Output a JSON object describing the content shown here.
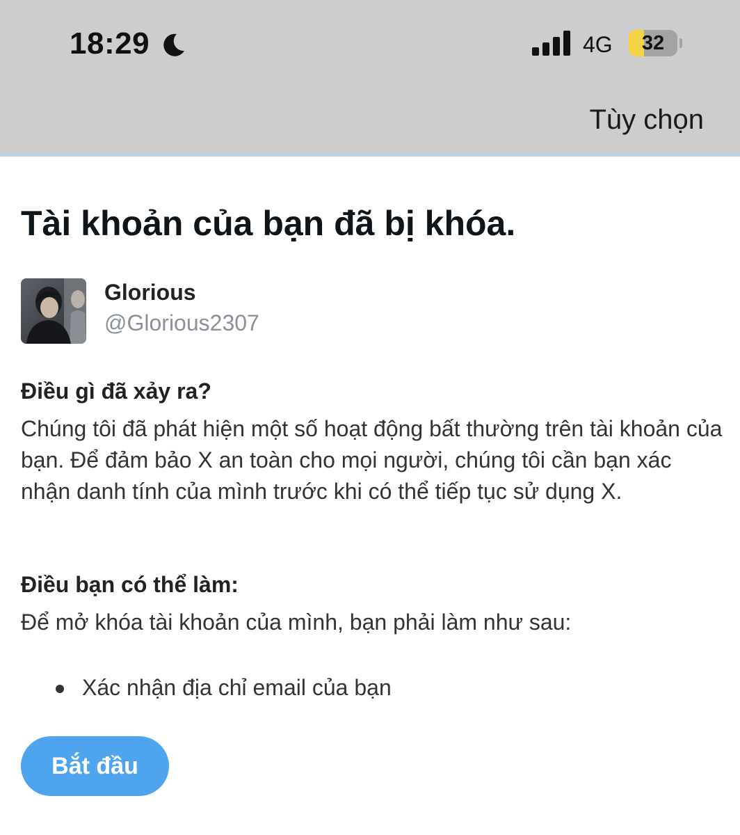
{
  "status_bar": {
    "time": "18:29",
    "network": "4G",
    "battery_percent": "32",
    "battery_level": 0.32,
    "icons": [
      "moon-icon",
      "signal-icon",
      "battery-icon"
    ],
    "battery_fill_color": "#f4d446"
  },
  "header": {
    "options_label": "Tùy chọn",
    "background_color": "#cdcdcd"
  },
  "main": {
    "title": "Tài khoản của bạn đã bị khóa.",
    "account": {
      "display_name": "Glorious",
      "username": "@Glorious2307"
    },
    "what_happened": {
      "heading": "Điều gì đã xảy ra?",
      "body": "Chúng tôi đã phát hiện một số hoạt động bất thường trên tài khoản của bạn. Để đảm bảo X an toàn cho mọi người, chúng tôi cần bạn xác nhận danh tính của mình trước khi có thể tiếp tục sử dụng X."
    },
    "what_you_can_do": {
      "heading": "Điều bạn có thể làm:",
      "body": "Để mở khóa tài khoản của mình, bạn phải làm như sau:",
      "steps": [
        "Xác nhận địa chỉ email của bạn"
      ]
    },
    "start_button_label": "Bắt đầu",
    "accent_color": "#4ea5ee"
  }
}
